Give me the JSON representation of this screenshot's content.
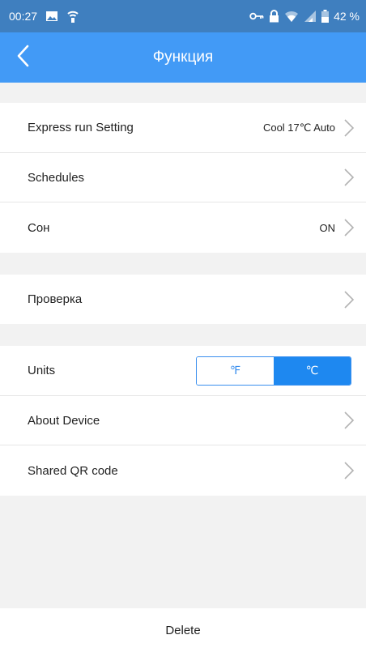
{
  "status_bar": {
    "time": "00:27",
    "battery": "42 %",
    "icons": [
      "image-icon",
      "wifi-signal-icon",
      "key-icon",
      "lock-icon",
      "wifi-icon",
      "cell-signal-icon",
      "battery-icon"
    ]
  },
  "app_bar": {
    "title": "Функция",
    "back_icon": "chevron-left-icon"
  },
  "rows": {
    "express_run": {
      "label": "Express run Setting",
      "value": "Cool 17℃ Auto"
    },
    "schedules": {
      "label": "Schedules"
    },
    "sleep": {
      "label": "Сон",
      "value": "ON"
    },
    "check": {
      "label": "Проверка"
    },
    "units": {
      "label": "Units",
      "options": [
        "℉",
        "℃"
      ],
      "selected": "℃"
    },
    "about": {
      "label": "About Device"
    },
    "shared_qr": {
      "label": "Shared QR code"
    }
  },
  "delete": {
    "label": "Delete"
  },
  "colors": {
    "app_bar": "#429af6",
    "status_bar": "#3f7fbf",
    "accent": "#1e88f0",
    "background": "#f2f2f2"
  }
}
